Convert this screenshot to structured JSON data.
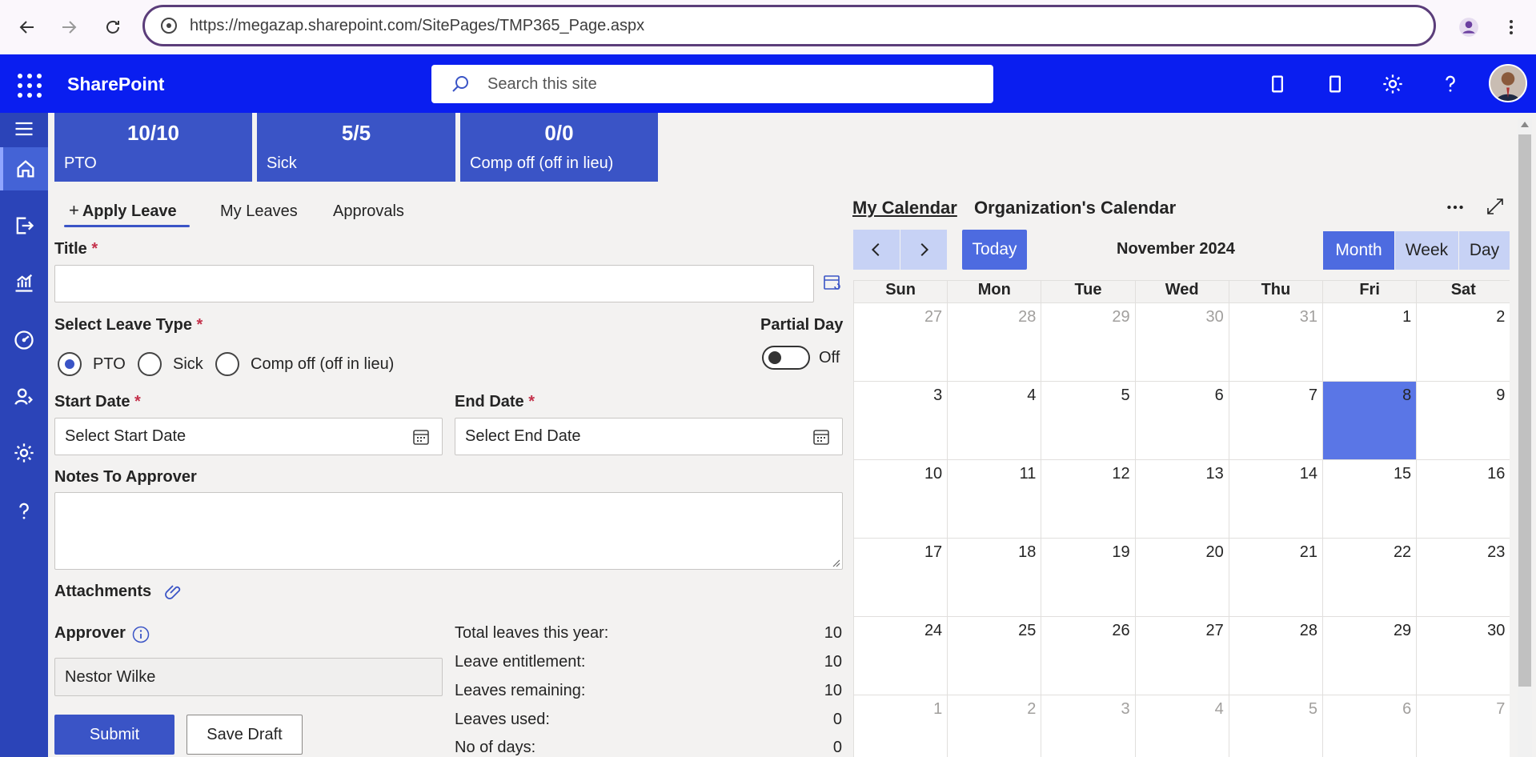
{
  "browser": {
    "url": "https://megazap.sharepoint.com/SitePages/TMP365_Page.aspx"
  },
  "suite": {
    "brand": "SharePoint",
    "search_placeholder": "Search this site"
  },
  "balances": [
    {
      "count": "10/10",
      "label": "PTO"
    },
    {
      "count": "5/5",
      "label": "Sick"
    },
    {
      "count": "0/0",
      "label": "Comp off (off in lieu)"
    }
  ],
  "tabs": {
    "apply": "Apply Leave",
    "my_leaves": "My Leaves",
    "approvals": "Approvals"
  },
  "form": {
    "title_label": "Title",
    "leave_type_label": "Select Leave Type",
    "leave_types": [
      "PTO",
      "Sick",
      "Comp off (off in lieu)"
    ],
    "selected_leave_type": "PTO",
    "partial_day_label": "Partial Day",
    "partial_day_state": "Off",
    "start_date_label": "Start Date",
    "start_date_placeholder": "Select Start Date",
    "end_date_label": "End Date",
    "end_date_placeholder": "Select End Date",
    "notes_label": "Notes To Approver",
    "attachments_label": "Attachments",
    "approver_label": "Approver",
    "approver_value": "Nestor Wilke",
    "required_mark": "*",
    "submit": "Submit",
    "save_draft": "Save Draft"
  },
  "stats": [
    {
      "label": "Total leaves this year:",
      "value": "10"
    },
    {
      "label": "Leave entitlement:",
      "value": "10"
    },
    {
      "label": "Leaves remaining:",
      "value": "10"
    },
    {
      "label": "Leaves used:",
      "value": "0"
    },
    {
      "label": "No of days:",
      "value": "0"
    }
  ],
  "calendar": {
    "my_calendar": "My Calendar",
    "org_calendar": "Organization's Calendar",
    "today": "Today",
    "month_label": "November 2024",
    "views": [
      "Month",
      "Week",
      "Day"
    ],
    "active_view": "Month",
    "weekdays": [
      "Sun",
      "Mon",
      "Tue",
      "Wed",
      "Thu",
      "Fri",
      "Sat"
    ],
    "weeks": [
      [
        {
          "d": "27",
          "m": true
        },
        {
          "d": "28",
          "m": true
        },
        {
          "d": "29",
          "m": true
        },
        {
          "d": "30",
          "m": true
        },
        {
          "d": "31",
          "m": true
        },
        {
          "d": "1"
        },
        {
          "d": "2"
        }
      ],
      [
        {
          "d": "3"
        },
        {
          "d": "4"
        },
        {
          "d": "5"
        },
        {
          "d": "6"
        },
        {
          "d": "7"
        },
        {
          "d": "8",
          "t": true
        },
        {
          "d": "9"
        }
      ],
      [
        {
          "d": "10"
        },
        {
          "d": "11"
        },
        {
          "d": "12"
        },
        {
          "d": "13"
        },
        {
          "d": "14"
        },
        {
          "d": "15"
        },
        {
          "d": "16"
        }
      ],
      [
        {
          "d": "17"
        },
        {
          "d": "18"
        },
        {
          "d": "19"
        },
        {
          "d": "20"
        },
        {
          "d": "21"
        },
        {
          "d": "22"
        },
        {
          "d": "23"
        }
      ],
      [
        {
          "d": "24"
        },
        {
          "d": "25"
        },
        {
          "d": "26"
        },
        {
          "d": "27"
        },
        {
          "d": "28"
        },
        {
          "d": "29"
        },
        {
          "d": "30"
        }
      ],
      [
        {
          "d": "1",
          "m": true
        },
        {
          "d": "2",
          "m": true
        },
        {
          "d": "3",
          "m": true
        },
        {
          "d": "4",
          "m": true
        },
        {
          "d": "5",
          "m": true
        },
        {
          "d": "6",
          "m": true
        },
        {
          "d": "7",
          "m": true
        }
      ]
    ]
  },
  "colors": {
    "suite_bar": "#0a1ef0",
    "rail": "#2b44b8",
    "accent": "#3a54c6",
    "today_cell": "#5a76e6"
  }
}
